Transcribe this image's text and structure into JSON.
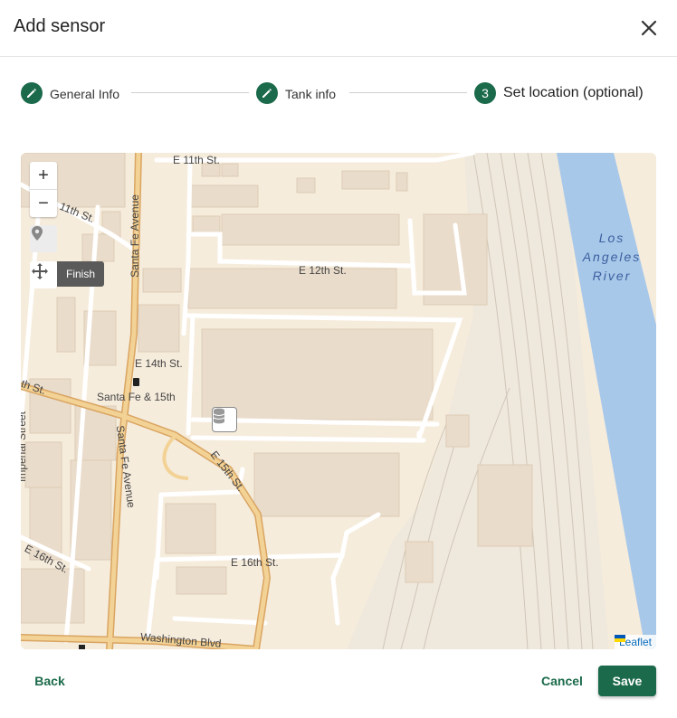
{
  "dialog": {
    "title": "Add sensor"
  },
  "stepper": {
    "steps": [
      {
        "label": "General Info",
        "status": "completed",
        "icon": "pencil-icon"
      },
      {
        "label": "Tank info",
        "status": "completed",
        "icon": "pencil-icon"
      },
      {
        "label": "Set location (optional)",
        "status": "active",
        "number": "3"
      }
    ]
  },
  "map": {
    "controls": {
      "zoom_in": "+",
      "zoom_out": "−",
      "finish_label": "Finish"
    },
    "labels": {
      "e11": "E 11th St.",
      "st11": "11th St.",
      "santa_fe_top": "Santa Fe Avenue",
      "e12": "E 12th St.",
      "e14": "E 14th St.",
      "santa_fe_15": "Santa Fe & 15th",
      "th_st": "th St.",
      "imperial": "Imperial Street",
      "santa_fe_bottom": "Santa Fe Avenue",
      "e15": "E 15th St.",
      "e16_left": "E 16th St.",
      "e16": "E 16th St.",
      "washington": "Washington Blvd",
      "river_line1": "Los",
      "river_line2": "Angeles",
      "river_line3": "River"
    },
    "attribution": "Leaflet",
    "colors": {
      "land": "#f6ecdc",
      "river": "#a8c8ea",
      "major_road": "#f2c98a",
      "building": "#eadccb"
    }
  },
  "footer": {
    "back_label": "Back",
    "cancel_label": "Cancel",
    "save_label": "Save"
  },
  "colors": {
    "accent": "#1b6a4b"
  }
}
